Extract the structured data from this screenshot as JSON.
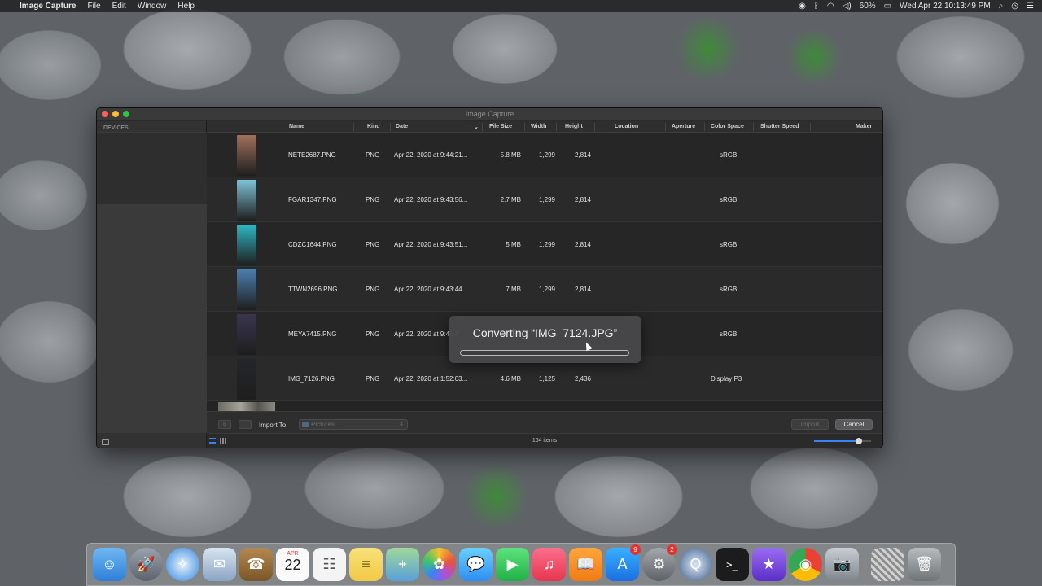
{
  "menubar": {
    "app_name": "Image Capture",
    "menus": [
      "File",
      "Edit",
      "Window",
      "Help"
    ],
    "battery": "60%",
    "clock": "Wed Apr 22  10:13:49 PM"
  },
  "window": {
    "title": "Image Capture",
    "sidebar_section": "DEVICES",
    "columns": {
      "name": "Name",
      "kind": "Kind",
      "date": "Date",
      "file_size": "File Size",
      "width": "Width",
      "height": "Height",
      "location": "Location",
      "aperture": "Aperture",
      "color_space": "Color Space",
      "shutter_speed": "Shutter Speed",
      "maker": "Maker"
    },
    "rows": [
      {
        "name": "NETE2687.PNG",
        "kind": "PNG",
        "date": "Apr 22, 2020 at 9:44:21...",
        "size": "5.8 MB",
        "width": "1,299",
        "height": "2,814",
        "color_space": "sRGB",
        "thumb_color": "#a0705c"
      },
      {
        "name": "FGAR1347.PNG",
        "kind": "PNG",
        "date": "Apr 22, 2020 at 9:43:56...",
        "size": "2.7 MB",
        "width": "1,299",
        "height": "2,814",
        "color_space": "sRGB",
        "thumb_color": "#7fc2d8"
      },
      {
        "name": "CDZC1644.PNG",
        "kind": "PNG",
        "date": "Apr 22, 2020 at 9:43:51...",
        "size": "5 MB",
        "width": "1,299",
        "height": "2,814",
        "color_space": "sRGB",
        "thumb_color": "#2eb7c4"
      },
      {
        "name": "TTWN2696.PNG",
        "kind": "PNG",
        "date": "Apr 22, 2020 at 9:43:44...",
        "size": "7 MB",
        "width": "1,299",
        "height": "2,814",
        "color_space": "sRGB",
        "thumb_color": "#4b7fb0"
      },
      {
        "name": "MEYA7415.PNG",
        "kind": "PNG",
        "date": "Apr 22, 2020 at 9:43:4",
        "size": "",
        "width": "",
        "height": "",
        "color_space": "sRGB",
        "thumb_color": "#3a3550"
      },
      {
        "name": "IMG_7126.PNG",
        "kind": "PNG",
        "date": "Apr 22, 2020 at 1:52:03...",
        "size": "4.6 MB",
        "width": "1,125",
        "height": "2,436",
        "color_space": "Display P3",
        "thumb_color": "#24262b"
      }
    ],
    "import_to_label": "Import To:",
    "import_to_value": "Pictures",
    "counter_value": "5",
    "import_button": "Import",
    "cancel_button": "Cancel",
    "item_count": "164 items",
    "thumbnail_size_fraction": 0.78
  },
  "dialog": {
    "message": "Converting “IMG_7124.JPG”",
    "progress_fraction": 0.0
  },
  "dock": {
    "calendar_month": "APR",
    "calendar_day": "22",
    "app_store_badge": "9",
    "system_prefs_badge": "2"
  },
  "colors": {
    "accent": "#3b82f6",
    "window_bg": "#242425"
  }
}
